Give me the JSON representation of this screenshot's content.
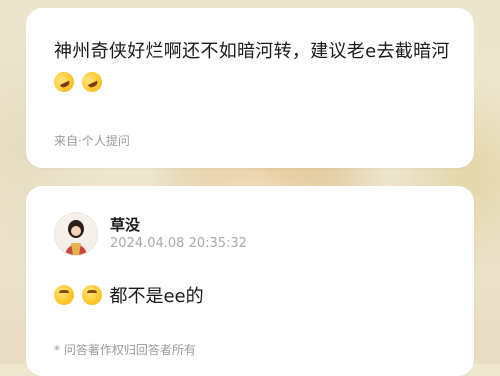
{
  "question": {
    "text": "神州奇侠好烂啊还不如暗河转，建议老e去截暗河",
    "emojis": [
      "rofl-emoji",
      "rofl-emoji"
    ],
    "source": "来自·个人提问"
  },
  "answer": {
    "user_name": "草没",
    "timestamp": "2024.04.08 20:35:32",
    "emojis": [
      "upside-down-face-emoji",
      "upside-down-face-emoji"
    ],
    "text": "都不是ee的",
    "copyright": "* 问答著作权归回答者所有"
  }
}
